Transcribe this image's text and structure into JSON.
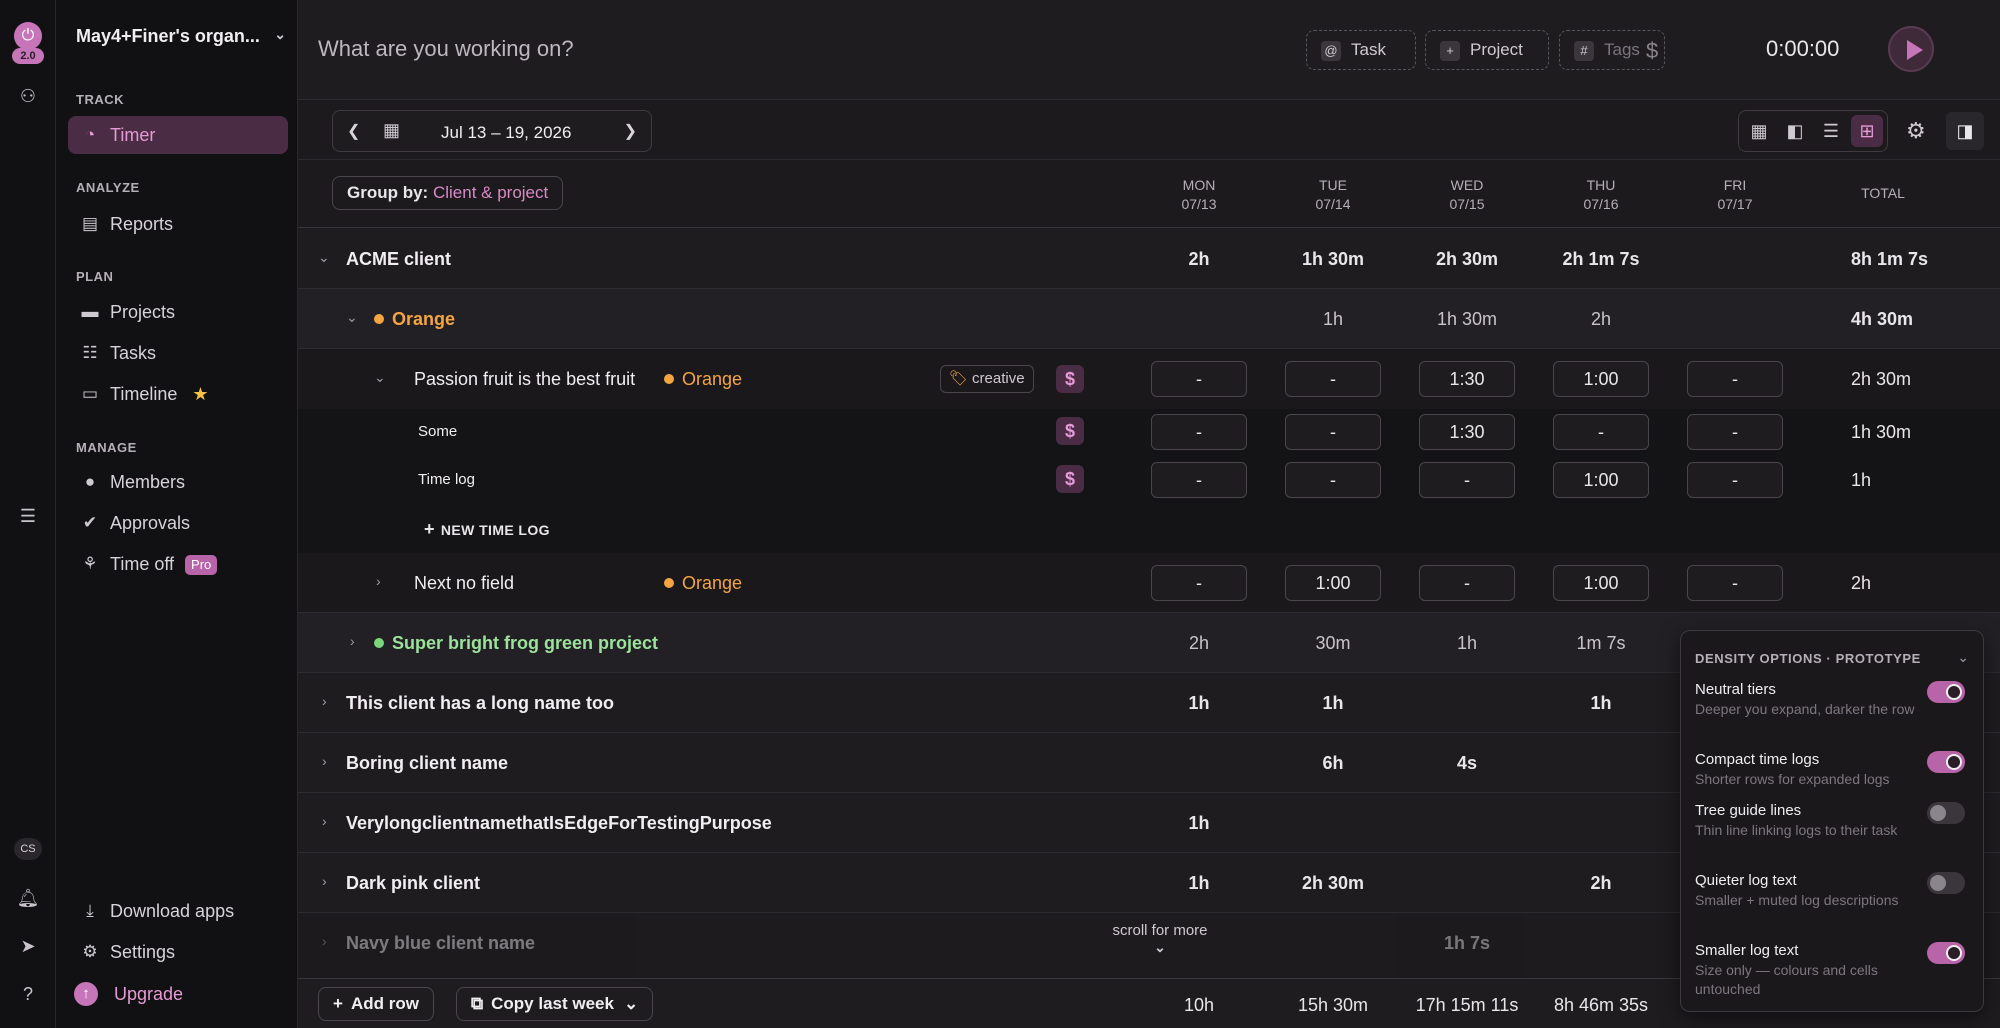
{
  "rail": {
    "version": "2.0",
    "initials": "CS"
  },
  "sidebar": {
    "org_name": "May4+Finer's organ...",
    "sections": {
      "track": "TRACK",
      "analyze": "ANALYZE",
      "plan": "PLAN",
      "manage": "MANAGE"
    },
    "items": [
      {
        "label": "Timer",
        "icon": "clock-icon",
        "active": true
      },
      {
        "label": "Reports",
        "icon": "report-icon"
      },
      {
        "label": "Projects",
        "icon": "folder-icon"
      },
      {
        "label": "Tasks",
        "icon": "list-icon"
      },
      {
        "label": "Timeline",
        "icon": "timeline-icon"
      },
      {
        "label": "Members",
        "icon": "person-icon"
      },
      {
        "label": "Approvals",
        "icon": "check-circle-icon"
      },
      {
        "label": "Time off",
        "icon": "palm-tree-icon",
        "badge": "Pro"
      }
    ],
    "bottom": {
      "download": "Download apps",
      "settings": "Settings",
      "upgrade": "Upgrade"
    }
  },
  "topbar": {
    "placeholder": "What are you working on?",
    "task_chip": "Task",
    "project_chip": "Project",
    "tags_chip": "Tags",
    "timer": "0:00:00"
  },
  "datebar": {
    "range": "Jul 13 – 19, 2026"
  },
  "header": {
    "group_label": "Group by:",
    "group_value": "Client & project",
    "days": [
      {
        "name": "MON",
        "date": "07/13"
      },
      {
        "name": "TUE",
        "date": "07/14"
      },
      {
        "name": "WED",
        "date": "07/15"
      },
      {
        "name": "THU",
        "date": "07/16"
      },
      {
        "name": "FRI",
        "date": "07/17"
      }
    ],
    "total": "TOTAL"
  },
  "rows": {
    "acme": {
      "name": "ACME client",
      "cells": [
        "2h",
        "1h 30m",
        "2h 30m",
        "2h 1m 7s",
        ""
      ],
      "total": "8h 1m 7s"
    },
    "orange": {
      "name": "Orange",
      "cells": [
        "",
        "1h",
        "1h 30m",
        "2h",
        ""
      ],
      "total": "4h 30m"
    },
    "passion": {
      "name": "Passion fruit is the best fruit",
      "project": "Orange",
      "tag": "creative",
      "cells": [
        "-",
        "-",
        "1:30",
        "1:00",
        "-"
      ],
      "total": "2h 30m"
    },
    "some": {
      "name": "Some",
      "cells": [
        "-",
        "-",
        "1:30",
        "-",
        "-"
      ],
      "total": "1h 30m"
    },
    "timelog": {
      "name": "Time log",
      "cells": [
        "-",
        "-",
        "-",
        "1:00",
        "-"
      ],
      "total": "1h"
    },
    "new_time_log": "NEW TIME LOG",
    "nextnofield": {
      "name": "Next no field",
      "project": "Orange",
      "cells": [
        "-",
        "1:00",
        "-",
        "1:00",
        "-"
      ],
      "total": "2h"
    },
    "frog": {
      "name": "Super bright frog green project",
      "cells": [
        "2h",
        "30m",
        "1h",
        "1m 7s"
      ]
    },
    "longname": {
      "name": "This client has a long name too",
      "cells": [
        "1h",
        "1h",
        "",
        "1h"
      ]
    },
    "boring": {
      "name": "Boring client name",
      "cells": [
        "",
        "6h",
        "4s",
        ""
      ]
    },
    "verylong": {
      "name": "VerylongclientnamethatIsEdgeForTestingPurpose",
      "cells": [
        "1h",
        "",
        "",
        ""
      ]
    },
    "darkpink": {
      "name": "Dark pink client",
      "cells": [
        "1h",
        "2h 30m",
        "",
        "2h"
      ]
    },
    "navy": {
      "name": "Navy blue client name",
      "cells": [
        "",
        "",
        "1h 7s",
        ""
      ]
    }
  },
  "scroll_hint": "scroll for more",
  "footer": {
    "add_row": "Add row",
    "copy_last_week": "Copy last week",
    "totals": [
      "10h",
      "15h 30m",
      "17h 15m 11s",
      "8h 46m 35s"
    ]
  },
  "density": {
    "title": "DENSITY OPTIONS · PROTOTYPE",
    "options": [
      {
        "name": "Neutral tiers",
        "desc": "Deeper you expand, darker the row",
        "on": true
      },
      {
        "name": "Compact time logs",
        "desc": "Shorter rows for expanded logs",
        "on": true
      },
      {
        "name": "Tree guide lines",
        "desc": "Thin line linking logs to their task",
        "on": false
      },
      {
        "name": "Quieter log text",
        "desc": "Smaller + muted log descriptions",
        "on": false
      },
      {
        "name": "Smaller log text",
        "desc": "Size only — colours and cells untouched",
        "on": true
      }
    ]
  },
  "colors": {
    "accent": "#c775b9",
    "orange": "#f5a540",
    "green": "#7bd67b"
  }
}
